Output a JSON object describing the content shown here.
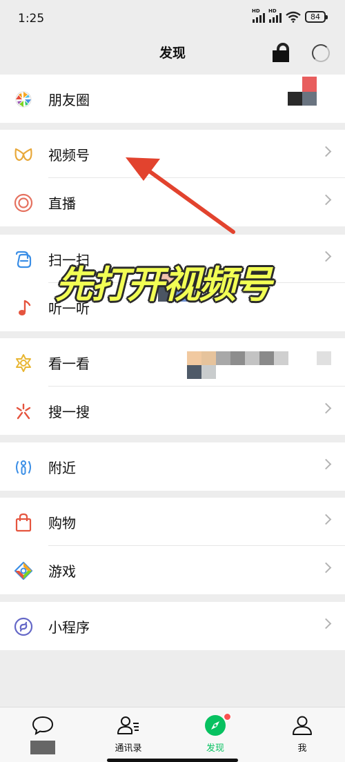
{
  "status_bar": {
    "time": "1:25",
    "signal_badge_1": "HD",
    "signal_badge_2": "HD",
    "battery": "84"
  },
  "nav": {
    "title": "发现"
  },
  "menu": {
    "moments": "朋友圈",
    "channels": "视频号",
    "live": "直播",
    "scan": "扫一扫",
    "shake": "听一听",
    "top_stories": "看一看",
    "search": "搜一搜",
    "nearby": "附近",
    "shopping": "购物",
    "games": "游戏",
    "mini_programs": "小程序"
  },
  "overlay": {
    "caption": "先打开视频号",
    "caption_color": "#f2ff54",
    "arrow_color": "#e2432e"
  },
  "tabbar": {
    "chats": "",
    "contacts": "通讯录",
    "discover": "发现",
    "me": "我",
    "active_tab": "discover",
    "accent": "#07c160"
  },
  "colors": {
    "background": "#ededed",
    "badge": "#fa5151"
  }
}
